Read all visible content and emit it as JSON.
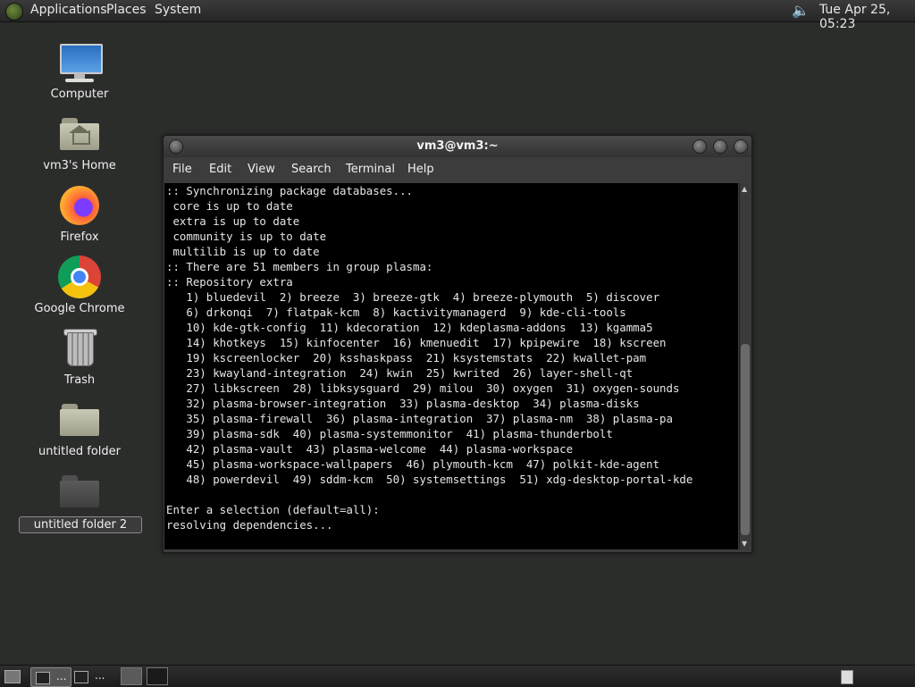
{
  "top_panel": {
    "menus": [
      "Applications",
      "Places",
      "System"
    ],
    "clock": "Tue Apr 25, 05:23",
    "volume_icon": "speaker-icon"
  },
  "desktop_icons": [
    {
      "label": "Computer",
      "icon": "computer-icon"
    },
    {
      "label": "vm3's Home",
      "icon": "home-folder-icon"
    },
    {
      "label": "Firefox",
      "icon": "firefox-icon"
    },
    {
      "label": "Google Chrome",
      "icon": "chrome-icon"
    },
    {
      "label": "Trash",
      "icon": "trash-icon"
    },
    {
      "label": "untitled folder",
      "icon": "folder-icon"
    },
    {
      "label": "untitled folder 2",
      "icon": "folder-icon",
      "selected": true
    }
  ],
  "terminal": {
    "title": "vm3@vm3:~",
    "menu": [
      "File",
      "Edit",
      "View",
      "Search",
      "Terminal",
      "Help"
    ],
    "lines": [
      ":: Synchronizing package databases...",
      " core is up to date",
      " extra is up to date",
      " community is up to date",
      " multilib is up to date",
      ":: There are 51 members in group plasma:",
      ":: Repository extra",
      "   1) bluedevil  2) breeze  3) breeze-gtk  4) breeze-plymouth  5) discover",
      "   6) drkonqi  7) flatpak-kcm  8) kactivitymanagerd  9) kde-cli-tools",
      "   10) kde-gtk-config  11) kdecoration  12) kdeplasma-addons  13) kgamma5",
      "   14) khotkeys  15) kinfocenter  16) kmenuedit  17) kpipewire  18) kscreen",
      "   19) kscreenlocker  20) ksshaskpass  21) ksystemstats  22) kwallet-pam",
      "   23) kwayland-integration  24) kwin  25) kwrited  26) layer-shell-qt",
      "   27) libkscreen  28) libksysguard  29) milou  30) oxygen  31) oxygen-sounds",
      "   32) plasma-browser-integration  33) plasma-desktop  34) plasma-disks",
      "   35) plasma-firewall  36) plasma-integration  37) plasma-nm  38) plasma-pa",
      "   39) plasma-sdk  40) plasma-systemmonitor  41) plasma-thunderbolt",
      "   42) plasma-vault  43) plasma-welcome  44) plasma-workspace",
      "   45) plasma-workspace-wallpapers  46) plymouth-kcm  47) polkit-kde-agent",
      "   48) powerdevil  49) sddm-kcm  50) systemsettings  51) xdg-desktop-portal-kde",
      "",
      "Enter a selection (default=all):",
      "resolving dependencies..."
    ]
  },
  "bottom_panel": {
    "show_desktop_icon": "show-desktop-icon",
    "tasks": [
      "...",
      "..."
    ],
    "workspaces": 2,
    "active_workspace": 1
  }
}
